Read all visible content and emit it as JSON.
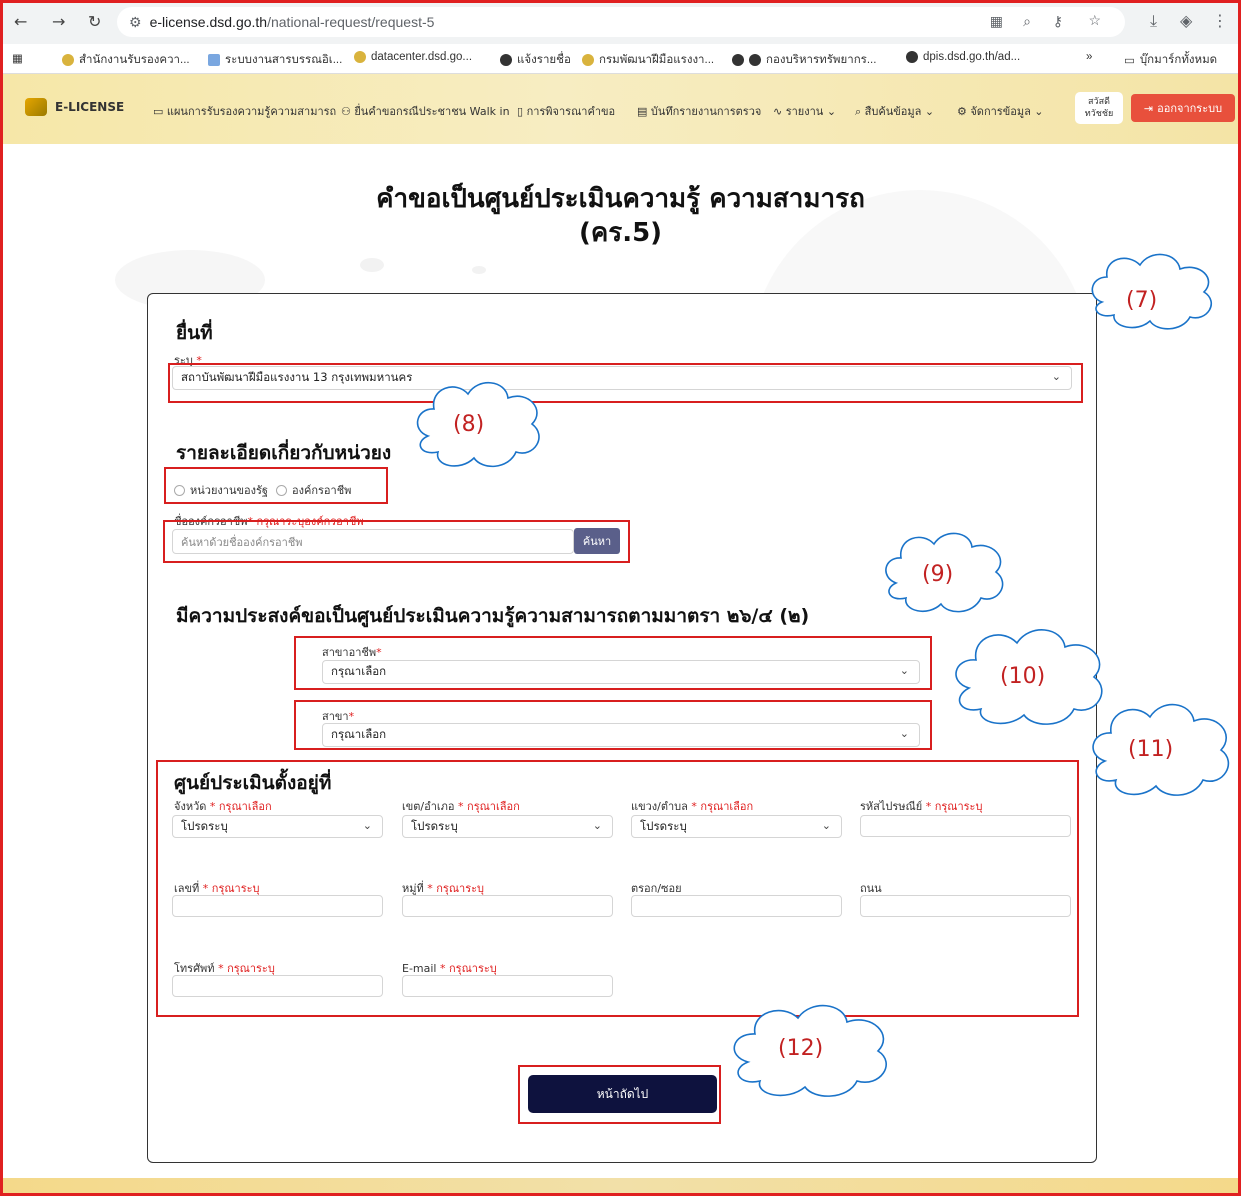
{
  "browser": {
    "url_host": "e-license.dsd.go.th",
    "url_path": "/national-request/request-5",
    "bookmarks": [
      "สำนักงานรับรองควา...",
      "ระบบงานสารบรรณอิเ...",
      "datacenter.dsd.go...",
      "แจ้งรายชื่อ",
      "กรมพัฒนาฝีมือแรงงา...",
      "กองบริหารทรัพยากร...",
      "dpis.dsd.go.th/ad..."
    ],
    "more_label": "»",
    "all_bookmarks": "บุ๊กมาร์กทั้งหมด"
  },
  "app": {
    "logo": "E-LICENSE",
    "nav": [
      "แผนการรับรองความรู้ความสามารถ",
      "ยื่นคำขอกรณีประชาชน Walk in",
      "การพิจารณาคำขอ",
      "บันทึกรายงานการตรวจ",
      "รายงาน",
      "สืบค้นข้อมูล",
      "จัดการข้อมูล"
    ],
    "user_greeting": "สวัสดี",
    "user_name": "ทวัชชัย",
    "logout": "ออกจากระบบ"
  },
  "page": {
    "title_line1": "คำขอเป็นศูนย์ประเมินความรู้ ความสามารถ",
    "title_line2": "(คร.5)"
  },
  "form": {
    "submit_at_heading": "ยื่นที่",
    "specify_label": "ระบุ",
    "institute_value": "สถาบันพัฒนาฝีมือแรงงาน 13 กรุงเทพมหานคร",
    "agency_heading": "รายละเอียดเกี่ยวกับหน่วยง",
    "radio_gov": "หน่วยงานของรัฐ",
    "radio_org": "องค์กรอาชีพ",
    "org_name_label": "ชื่อองค์กรอาชีพ",
    "org_name_hint": "กรุณาระบุองค์กรอาชีพ",
    "org_search_placeholder": "ค้นหาด้วยชื่อองค์กรอาชีพ",
    "search_button": "ค้นหา",
    "purpose_heading": "มีความประสงค์ขอเป็นศูนย์ประเมินความรู้ความสามารถตามมาตรา ๒๖/๔ (๒)",
    "occupation_label": "สาขาอาชีพ",
    "occupation_value": "กรุณาเลือก",
    "branch_label": "สาขา",
    "branch_value": "กรุณาเลือก",
    "location_heading": "ศูนย์ประเมินตั้งอยู่ที่",
    "province_label": "จังหวัด",
    "province_hint": "กรุณาเลือก",
    "province_value": "โปรดระบุ",
    "district_label": "เขต/อำเภอ",
    "district_hint": "กรุณาเลือก",
    "district_value": "โปรดระบุ",
    "subdistrict_label": "แขวง/ตำบล",
    "subdistrict_hint": "กรุณาเลือก",
    "subdistrict_value": "โปรดระบุ",
    "postal_label": "รหัสไปรษณีย์",
    "postal_hint": "กรุณาระบุ",
    "house_no_label": "เลขที่",
    "house_no_hint": "กรุณาระบุ",
    "moo_label": "หมู่ที่",
    "moo_hint": "กรุณาระบุ",
    "soi_label": "ตรอก/ซอย",
    "road_label": "ถนน",
    "phone_label": "โทรศัพท์",
    "phone_hint": "กรุณาระบุ",
    "email_label": "E-mail",
    "email_hint": "กรุณาระบุ",
    "next_button": "หน้าถัดไป"
  },
  "annotations": [
    "(7)",
    "(8)",
    "(9)",
    "(10)",
    "(11)",
    "(12)"
  ],
  "colors": {
    "annotation_red": "#d81f1f",
    "logout_bg": "#e8503c",
    "next_button_bg": "#0e123e",
    "search_button_bg": "#5a5f8a"
  }
}
